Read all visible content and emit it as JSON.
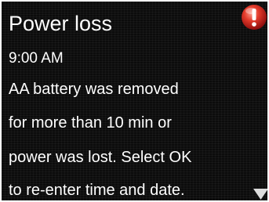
{
  "dialog": {
    "title": "Power loss",
    "time": "9:00 AM",
    "message_lines": [
      "AA battery was removed",
      "for more than 10 min or",
      "power was lost. Select OK",
      "to re-enter time and date."
    ]
  },
  "icons": {
    "alert": "alert-exclamation-icon",
    "scroll": "scroll-down-arrow-icon"
  },
  "colors": {
    "background": "#0c0c0c",
    "text": "#ffffff",
    "alert_red": "#d42020",
    "arrow": "#dcdcdc"
  }
}
